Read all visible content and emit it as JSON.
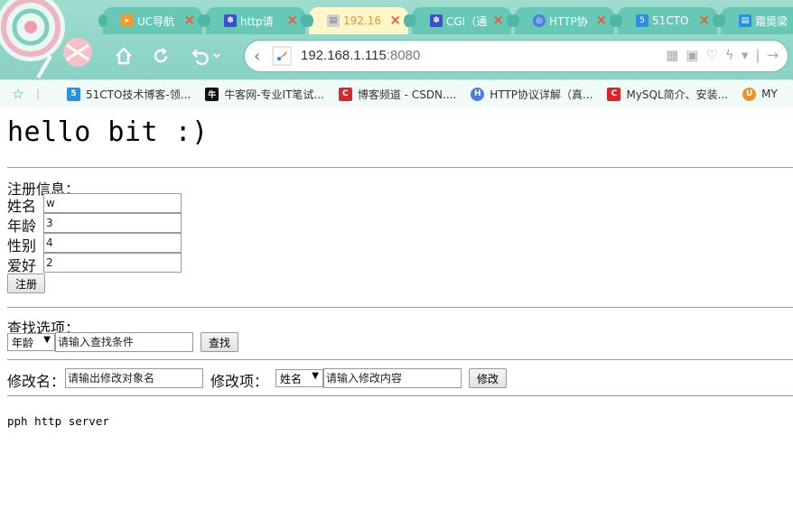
{
  "tabs": [
    {
      "label": "UC导航",
      "icon": "uc-nav-icon",
      "color": "#f39a2b"
    },
    {
      "label": "http请",
      "icon": "paw-icon",
      "color": "#3a4fd1"
    },
    {
      "label": "192.16",
      "icon": "page-icon",
      "color": "#d0d0d0"
    },
    {
      "label": "CGI（通",
      "icon": "paw-icon",
      "color": "#3a4fd1"
    },
    {
      "label": "HTTP协",
      "icon": "globe-icon",
      "color": "#4a7ee0"
    },
    {
      "label": "51CTO",
      "icon": "51cto-icon",
      "color": "#2b8fe0"
    },
    {
      "label": "霜奨梁",
      "icon": "page-icon",
      "color": "#2b8fe0"
    }
  ],
  "address": {
    "host": "192.168.1.115",
    "port": ":8080"
  },
  "bookmarks": [
    {
      "label": "51CTO技术博客-领...",
      "icon_text": "5",
      "color": "#2b8fe0"
    },
    {
      "label": "牛客网-专业IT笔试...",
      "icon_text": "牛",
      "color": "#111111"
    },
    {
      "label": "博客频道 - CSDN....",
      "icon_text": "C",
      "color": "#d8262b"
    },
    {
      "label": "HTTP协议详解（真...",
      "icon_text": "H",
      "color": "#4a7ee0"
    },
    {
      "label": "MySQL简介、安装...",
      "icon_text": "C",
      "color": "#d8262b"
    },
    {
      "label": "MY",
      "icon_text": "U",
      "color": "#e8942b"
    }
  ],
  "page": {
    "heading": "hello bit :)",
    "register": {
      "title": "注册信息：",
      "fields": [
        {
          "label": "姓名",
          "value": "w"
        },
        {
          "label": "年龄",
          "value": "3"
        },
        {
          "label": "性别",
          "value": "4"
        },
        {
          "label": "爱好",
          "value": "2"
        }
      ],
      "submit": "注册"
    },
    "search": {
      "title": "查找选项：",
      "select": "年龄",
      "placeholder": "请输入查找条件",
      "button": "查找"
    },
    "modify": {
      "name_label": "修改名：",
      "name_placeholder": "请输出修改对象名",
      "item_label": "修改项：",
      "select": "姓名",
      "content_placeholder": "请输入修改内容",
      "button": "修改"
    },
    "footer": "pph http server"
  }
}
